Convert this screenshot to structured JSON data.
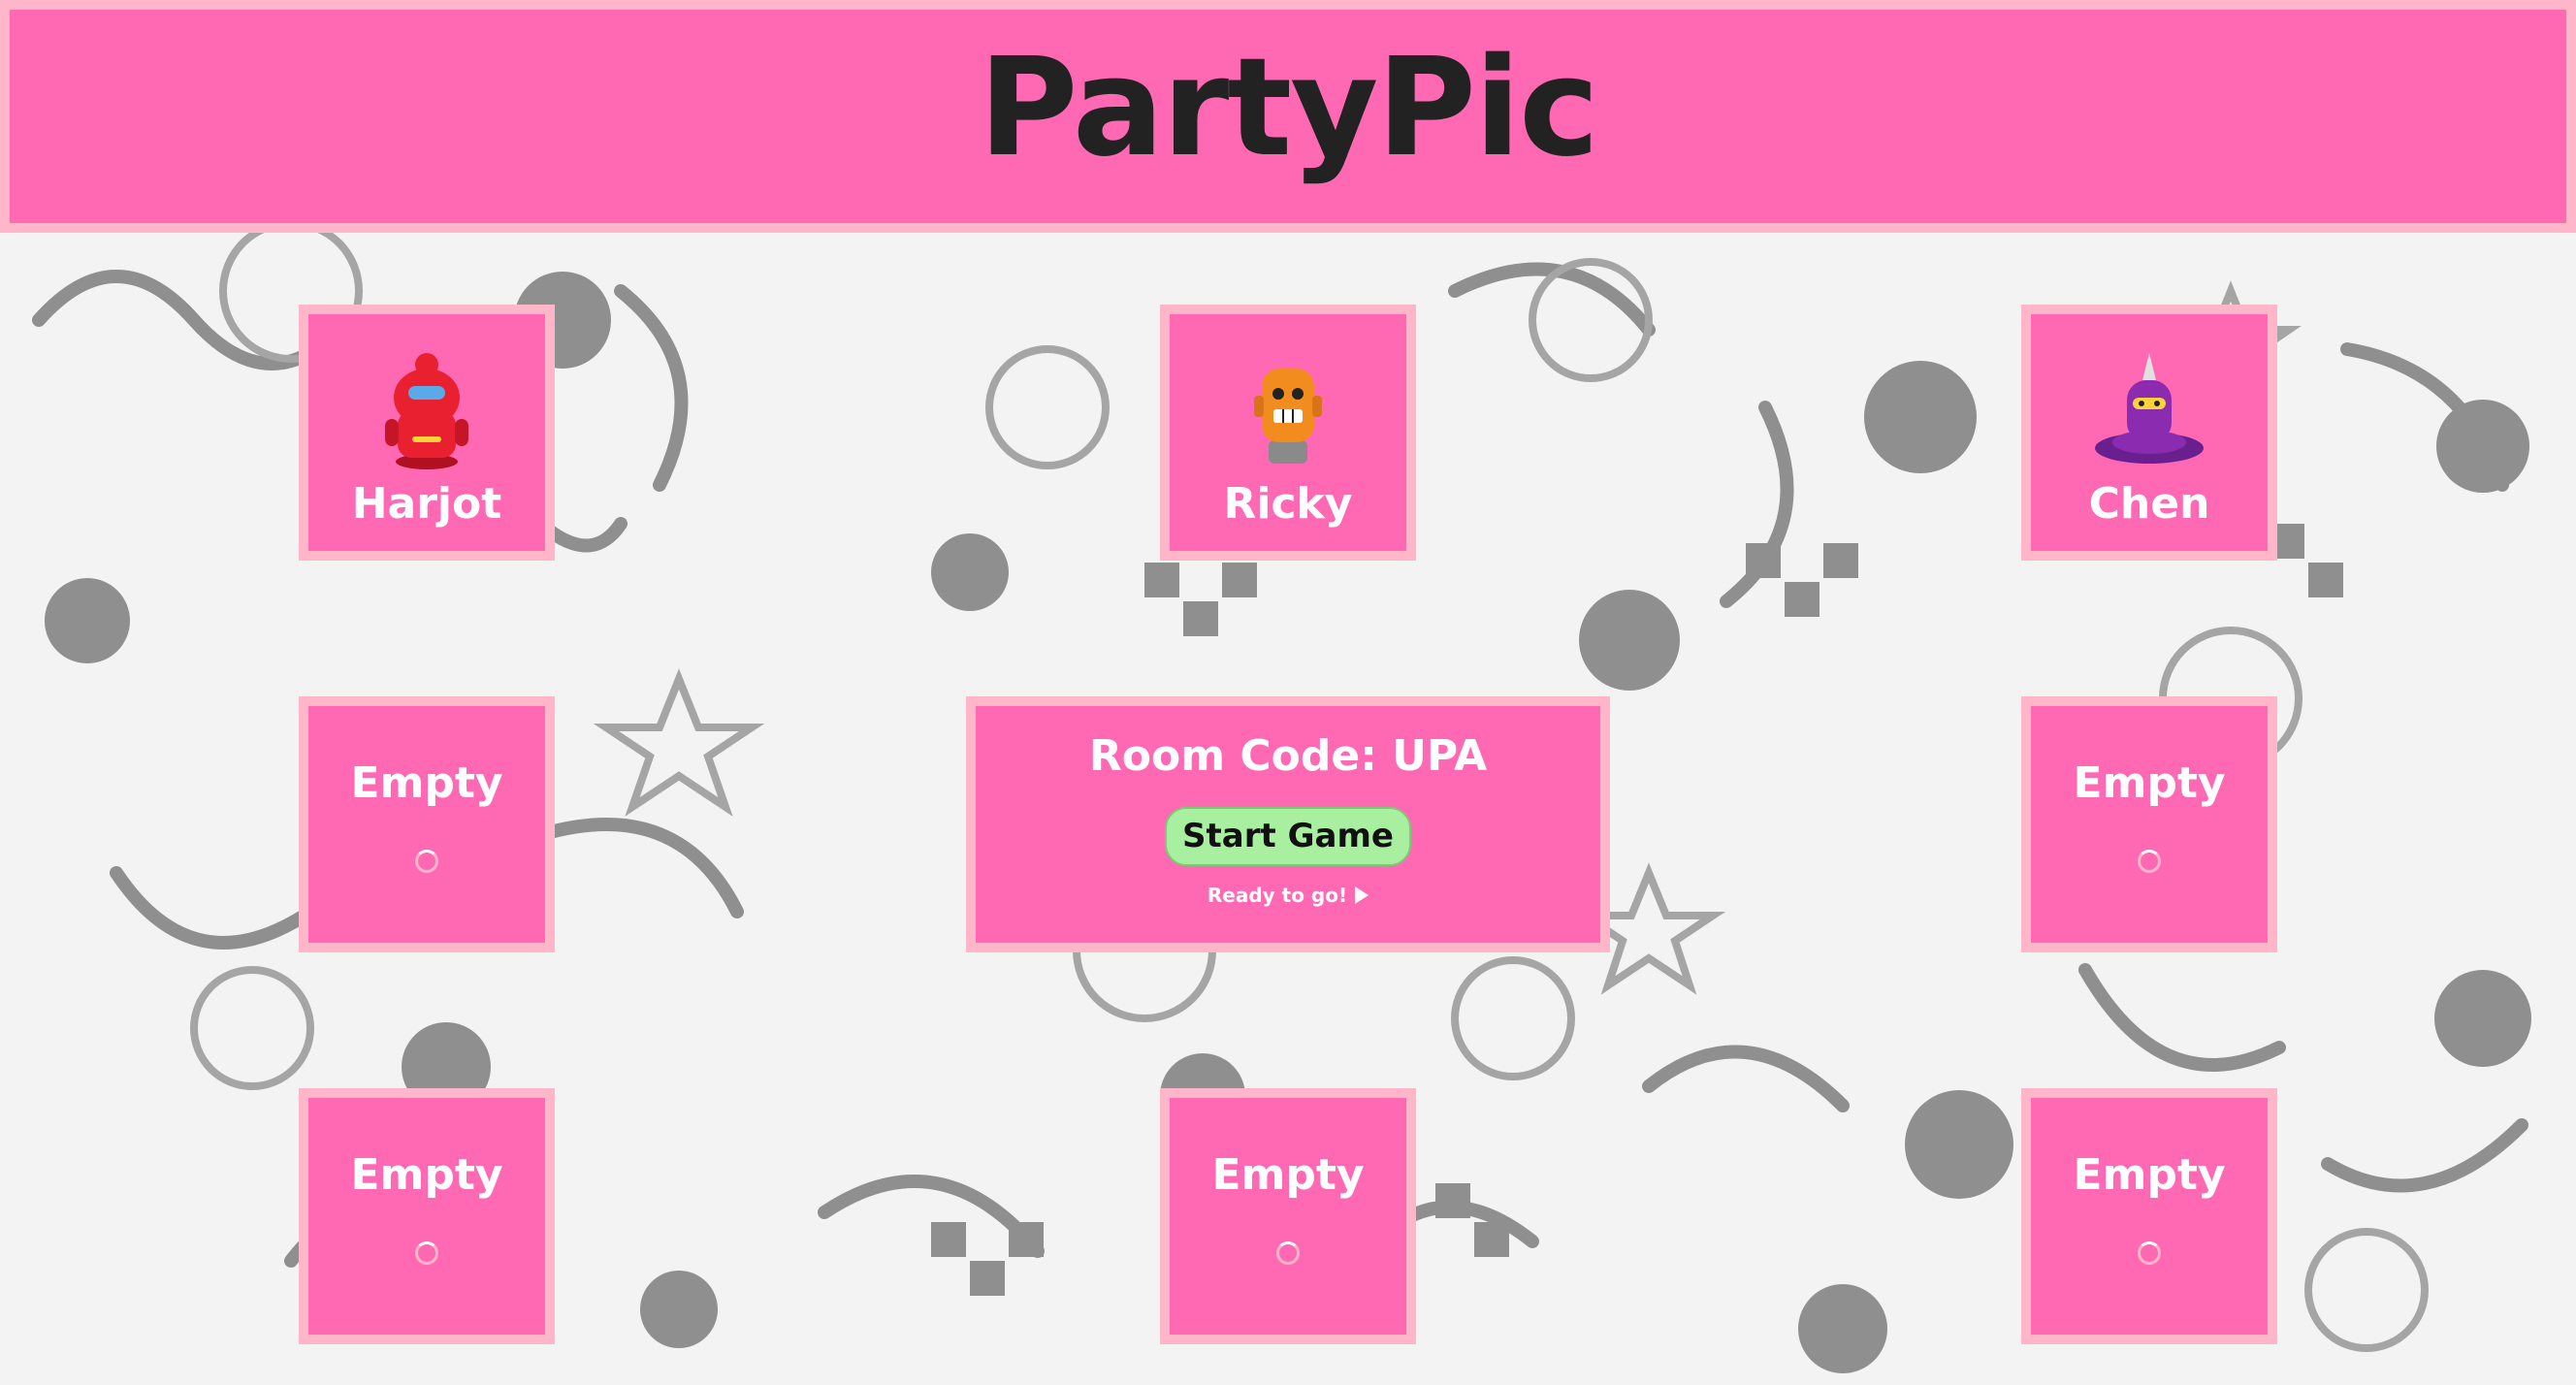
{
  "header": {
    "title": "PartyPic"
  },
  "players": [
    {
      "name": "Harjot",
      "avatar": "red-robot-icon",
      "color": "#e8202f"
    },
    {
      "name": "Ricky",
      "avatar": "orange-robot-icon",
      "color": "#f28c1e"
    },
    {
      "name": "Chen",
      "avatar": "purple-robot-icon",
      "color": "#8a2bb0"
    }
  ],
  "empty_slots": {
    "label": "Empty"
  },
  "room": {
    "code_label": "Room Code: UPA",
    "start_button": "Start Game",
    "ready_text": "Ready to go!"
  },
  "colors": {
    "card": "#ff69b4",
    "card_border": "#ffb6c8",
    "button": "#a8f0a0",
    "title_text": "#222222"
  }
}
